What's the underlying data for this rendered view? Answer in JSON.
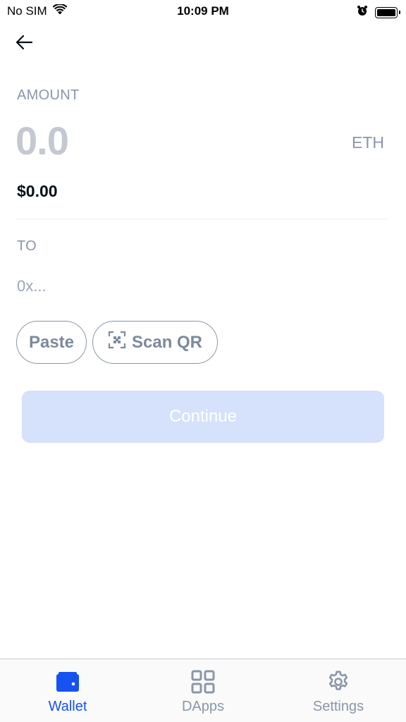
{
  "status_bar": {
    "carrier": "No SIM",
    "time": "10:09 PM",
    "icons": [
      "wifi-icon",
      "alarm-icon",
      "battery-icon"
    ]
  },
  "header": {
    "back_icon": "arrow-left-icon"
  },
  "amount": {
    "label": "AMOUNT",
    "value": "0.0",
    "currency": "ETH",
    "fiat_value": "$0.00"
  },
  "recipient": {
    "label": "TO",
    "placeholder": "0x...",
    "value": ""
  },
  "actions": {
    "paste_label": "Paste",
    "scan_label": "Scan QR",
    "scan_icon": "qr-scan-icon"
  },
  "continue": {
    "label": "Continue",
    "enabled": false
  },
  "tab_bar": {
    "active": "Wallet",
    "tabs": [
      {
        "label": "Wallet",
        "icon": "wallet-icon"
      },
      {
        "label": "DApps",
        "icon": "grid-icon"
      },
      {
        "label": "Settings",
        "icon": "gear-icon"
      }
    ]
  },
  "colors": {
    "accent": "#1652f0",
    "muted": "#8a97a8",
    "button_disabled": "#d6e1fb"
  }
}
